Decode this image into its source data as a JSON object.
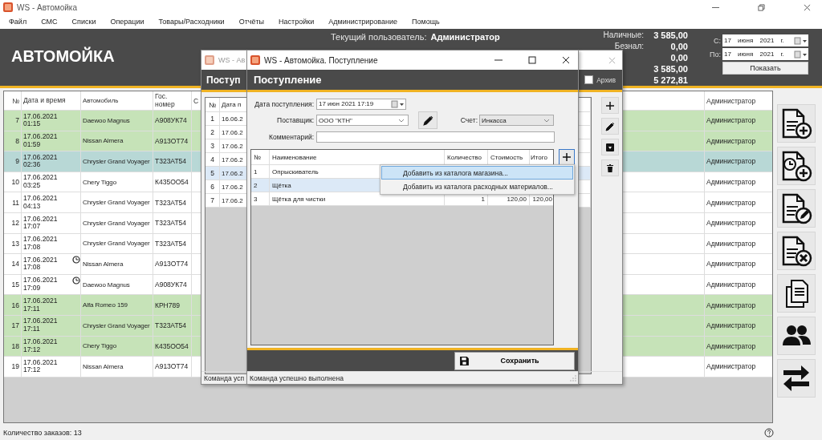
{
  "window": {
    "title": "WS - Автомойка"
  },
  "menu": [
    "Файл",
    "СМС",
    "Списки",
    "Операции",
    "Товары/Расходники",
    "Отчёты",
    "Настройки",
    "Администрирование",
    "Помощь"
  ],
  "header": {
    "title": "АВТОМОЙКА",
    "user_label": "Текущий пользователь:",
    "user": "Администратор",
    "totals": [
      {
        "label": "Наличные:",
        "value": "3 585,00"
      },
      {
        "label": "Безнал:",
        "value": "0,00"
      },
      {
        "value": "0,00"
      },
      {
        "value": "3 585,00"
      },
      {
        "value": "5 272,81"
      }
    ],
    "date_from": {
      "label": "С:",
      "value": "17 июня 2021 г."
    },
    "date_to": {
      "label": "По:",
      "value": "17 июня 2021 г."
    },
    "show_button": "Показать"
  },
  "orders": {
    "columns": [
      "№",
      "Дата и время",
      "Автомобиль",
      "Гос. номер",
      "С",
      "Администратор"
    ],
    "rows": [
      {
        "num": "7",
        "date": "17.06.2021",
        "time": "01:15",
        "car": "Daewoo Magnus",
        "plate": "А908УК74",
        "admin": "Администратор",
        "done": true,
        "scheduled": false,
        "selected": false
      },
      {
        "num": "8",
        "date": "17.06.2021",
        "time": "01:59",
        "car": "Nissan Almera",
        "plate": "А913ОТ74",
        "admin": "Администратор",
        "done": true,
        "scheduled": false,
        "selected": false
      },
      {
        "num": "9",
        "date": "17.06.2021",
        "time": "02:36",
        "car": "Chrysler Grand Voyager",
        "plate": "Т323АТ54",
        "admin": "Администратор",
        "done": false,
        "scheduled": false,
        "selected": true
      },
      {
        "num": "10",
        "date": "17.06.2021",
        "time": "03:25",
        "car": "Chery Tiggo",
        "plate": "К435ОО54",
        "admin": "Администратор",
        "done": false,
        "scheduled": false,
        "selected": false
      },
      {
        "num": "11",
        "date": "17.06.2021",
        "time": "04:13",
        "car": "Chrysler Grand Voyager",
        "plate": "Т323АТ54",
        "admin": "Администратор",
        "done": false,
        "scheduled": false,
        "selected": false
      },
      {
        "num": "12",
        "date": "17.06.2021",
        "time": "17:07",
        "car": "Chrysler Grand Voyager",
        "plate": "Т323АТ54",
        "admin": "Администратор",
        "done": false,
        "scheduled": false,
        "selected": false
      },
      {
        "num": "13",
        "date": "17.06.2021",
        "time": "17:08",
        "car": "Chrysler Grand Voyager",
        "plate": "Т323АТ54",
        "admin": "Администратор",
        "done": false,
        "scheduled": false,
        "selected": false
      },
      {
        "num": "14",
        "date": "17.06.2021",
        "time": "17:08",
        "car": "Nissan Almera",
        "plate": "А913ОТ74",
        "admin": "Администратор",
        "done": false,
        "scheduled": true,
        "selected": false
      },
      {
        "num": "15",
        "date": "17.06.2021",
        "time": "17:09",
        "car": "Daewoo Magnus",
        "plate": "А908УК74",
        "admin": "Администратор",
        "done": false,
        "scheduled": true,
        "selected": false
      },
      {
        "num": "16",
        "date": "17.06.2021",
        "time": "17:11",
        "car": "Alfa Romeo 159",
        "plate": "КРН789",
        "admin": "Администратор",
        "done": true,
        "scheduled": false,
        "selected": false
      },
      {
        "num": "17",
        "date": "17.06.2021",
        "time": "17:11",
        "car": "Chrysler Grand Voyager",
        "plate": "Т323АТ54",
        "admin": "Администратор",
        "done": true,
        "scheduled": false,
        "selected": false
      },
      {
        "num": "18",
        "date": "17.06.2021",
        "time": "17:12",
        "car": "Chery Tiggo",
        "plate": "К435ОО54",
        "admin": "Администратор",
        "done": true,
        "scheduled": false,
        "selected": false
      },
      {
        "num": "19",
        "date": "17.06.2021",
        "time": "17:12",
        "car": "Nissan Almera",
        "plate": "А913ОТ74",
        "admin": "Администратор",
        "done": false,
        "scheduled": false,
        "selected": false
      }
    ]
  },
  "status_bar": {
    "text": "Количество заказов: 13"
  },
  "receipts_window": {
    "title": "WS - Ав",
    "heading": "Поступ",
    "archive": {
      "label": "Архив",
      "checked": false
    },
    "columns": [
      "№",
      "Дата п"
    ],
    "rows": [
      {
        "num": "1",
        "date": "16.06.2",
        "selected": false
      },
      {
        "num": "2",
        "date": "17.06.2",
        "selected": false
      },
      {
        "num": "3",
        "date": "17.06.2",
        "selected": false
      },
      {
        "num": "4",
        "date": "17.06.2",
        "selected": false
      },
      {
        "num": "5",
        "date": "17.06.2",
        "selected": true
      },
      {
        "num": "6",
        "date": "17.06.2",
        "selected": false
      },
      {
        "num": "7",
        "date": "17.06.2",
        "selected": false
      }
    ],
    "status": "Команда усп"
  },
  "receipt_dialog": {
    "title": "WS - Автомойка. Поступление",
    "heading": "Поступление",
    "date": {
      "label": "Дата поступления:",
      "value": "17 июн 2021 17:19"
    },
    "supplier": {
      "label": "Поставщик:",
      "value": "ООО \"КТН\""
    },
    "account": {
      "label": "Счет:",
      "value": "Инкасса"
    },
    "comment": {
      "label": "Комментарий:"
    },
    "columns": [
      "№",
      "Наименование",
      "Количество",
      "Стоимость",
      "Итого"
    ],
    "rows": [
      {
        "num": "1",
        "name": "Опрыскиватель",
        "selected": false
      },
      {
        "num": "2",
        "name": "Щётка",
        "selected": true
      },
      {
        "num": "3",
        "name": "Щётка для чистки",
        "qty": "1",
        "cost": "120,00",
        "total": "120,00",
        "selected": false
      }
    ],
    "save_button": "Сохранить",
    "status": "Команда успешно выполнена"
  },
  "context_menu": [
    {
      "label": "Добавить из каталога магазина...",
      "selected": true
    },
    {
      "label": "Добавить из каталога расходных материалов...",
      "selected": false
    }
  ]
}
